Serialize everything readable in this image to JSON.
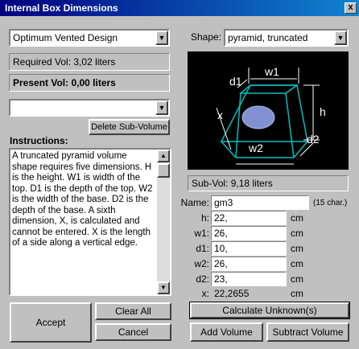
{
  "window": {
    "title": "Internal Box Dimensions",
    "close_glyph": "x"
  },
  "design_select": {
    "value": "Optimum Vented Design"
  },
  "required_vol": "Required Vol: 3,02 liters",
  "present_vol": "Present Vol: 0,00 liters",
  "subvolume_select": {
    "value": ""
  },
  "delete_subvolume_label": "Delete Sub-Volume",
  "instructions_label": "Instructions:",
  "instructions_text": "A truncated pyramid volume shape requires five dimensions. H is the height. W1 is width of the top. D1 is the depth of the top. W2 is the width of the base. D2 is the depth of the base. A sixth dimension, X, is calculated and cannot be entered. X is the length of a side along a vertical edge.",
  "shape": {
    "label": "Shape:",
    "value": "pyramid, truncated"
  },
  "diagram": {
    "labels": {
      "w1": "w1",
      "d1": "d1",
      "h": "h",
      "x": "x",
      "w2": "w2",
      "d2": "d2"
    },
    "colors": {
      "background": "#000000",
      "edges": "#00c0c0",
      "dims": "#ffffff",
      "hole": "#8090d0"
    }
  },
  "subvol": "Sub-Vol: 9,18 liters",
  "name": {
    "label": "Name:",
    "value": "gm3",
    "hint": "(15 char.)"
  },
  "dimensions": [
    {
      "label": "h:",
      "value": "22,",
      "unit": "cm"
    },
    {
      "label": "w1:",
      "value": "26,",
      "unit": "cm"
    },
    {
      "label": "d1:",
      "value": "10,",
      "unit": "cm"
    },
    {
      "label": "w2:",
      "value": "26,",
      "unit": "cm"
    },
    {
      "label": "d2:",
      "value": "23,",
      "unit": "cm"
    }
  ],
  "x_result": {
    "label": "x:",
    "value": "22,2655",
    "unit": "cm"
  },
  "buttons": {
    "accept": "Accept",
    "clear_all": "Clear All",
    "cancel": "Cancel",
    "calculate": "Calculate Unknown(s)",
    "add_volume": "Add Volume",
    "subtract_volume": "Subtract Volume"
  }
}
